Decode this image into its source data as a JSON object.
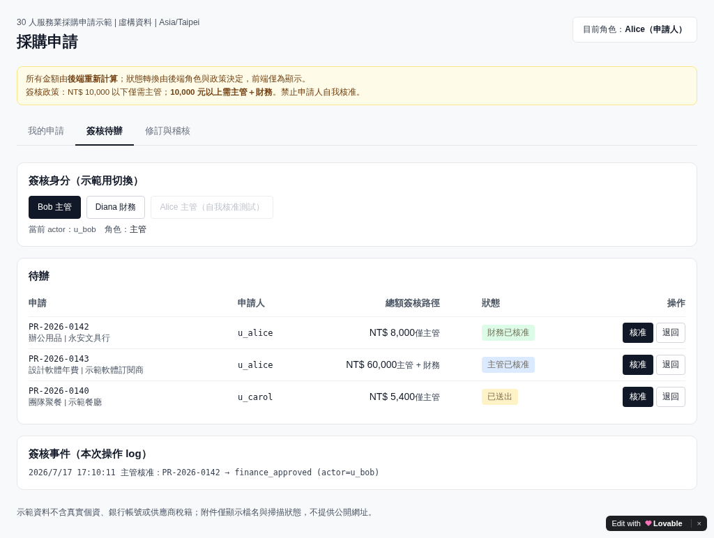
{
  "header": {
    "subtitle": "30 人服務業採購申請示範 | 虛構資料 | Asia/Taipei",
    "title": "採購申請",
    "role_label": "目前角色：",
    "role_value": "Alice（申請人）"
  },
  "notice": {
    "lines": [
      "所有金額由**後端重新計算**；狀態轉換由後端角色與政策決定，前端僅為顯示。",
      "簽核政策：NT$ 10,000 以下僅需主管；**10,000 元以上需主管＋財務**。禁止申請人自我核准。"
    ]
  },
  "tabs": [
    {
      "label": "我的申請",
      "selected": false
    },
    {
      "label": "簽核待辦",
      "selected": true
    },
    {
      "label": "修訂與稽核",
      "selected": false
    }
  ],
  "identity": {
    "title": "簽核身分（示範用切換）",
    "options": [
      {
        "label": "Bob 主管",
        "selected": true,
        "disabled": false
      },
      {
        "label": "Diana 財務",
        "selected": false,
        "disabled": false
      },
      {
        "label": "Alice 主管（自我核准測試）",
        "selected": false,
        "disabled": true
      }
    ],
    "actor_label": "當前 actor：u_bob",
    "role_label": "角色：",
    "role_value": "主管"
  },
  "todo": {
    "title": "待辦",
    "columns": [
      "申請",
      "申請人",
      "總額簽核路徑",
      "狀態",
      "操作"
    ],
    "rows": [
      {
        "id": "PR-2026-0142",
        "desc": "辦公用品 | 永安文具行",
        "applicant": "u_alice",
        "amount": "NT$ 8,000",
        "route": "僅主管",
        "status": {
          "label": "財務已核准",
          "color": "#dcfce7"
        },
        "approve": "核准",
        "reject": "退回"
      },
      {
        "id": "PR-2026-0143",
        "desc": "設計軟體年費 | 示範軟體訂閱商",
        "applicant": "u_alice",
        "amount": "NT$ 60,000",
        "route": "主管 + 財務",
        "status": {
          "label": "主管已核准",
          "color": "#dbeafe"
        },
        "approve": "核准",
        "reject": "退回"
      },
      {
        "id": "PR-2026-0140",
        "desc": "團隊聚餐 | 示範餐廳",
        "applicant": "u_carol",
        "amount": "NT$ 5,400",
        "route": "僅主管",
        "status": {
          "label": "已送出",
          "color": "#fef3c7"
        },
        "approve": "核准",
        "reject": "退回"
      }
    ]
  },
  "events": {
    "title": "簽核事件（本次操作 log）",
    "entries": [
      "2026/7/17 17:10:11 主管核准：PR-2026-0142 → finance_approved (actor=u_bob)"
    ]
  },
  "footer": "示範資料不含真實個資、銀行帳號或供應商稅籍；附件僅顯示檔名與掃描狀態，不提供公開網址。",
  "badge": {
    "prefix": "Edit with",
    "brand": "Lovable",
    "close": "×"
  }
}
